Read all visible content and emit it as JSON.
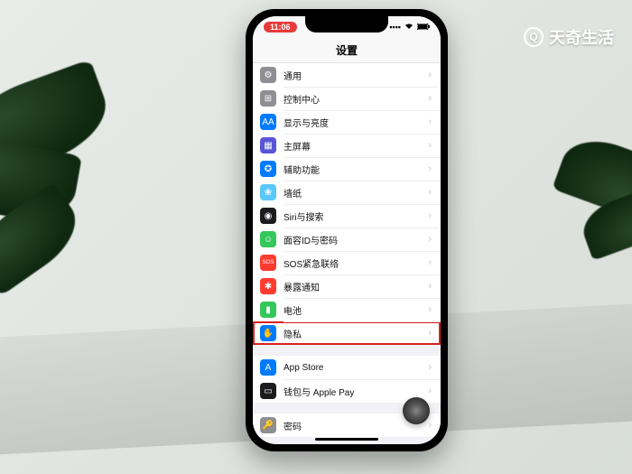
{
  "brand": {
    "text": "天奇生活",
    "icon_letter": "Q"
  },
  "statusbar": {
    "time": "11:06"
  },
  "navbar": {
    "title": "设置"
  },
  "groups": [
    {
      "rows": [
        {
          "name": "general",
          "label": "通用",
          "icon_bg": "bg-gray",
          "glyph": "⚙"
        },
        {
          "name": "control-center",
          "label": "控制中心",
          "icon_bg": "bg-gray",
          "glyph": "⊞"
        },
        {
          "name": "display",
          "label": "显示与亮度",
          "icon_bg": "bg-blue",
          "glyph": "AA"
        },
        {
          "name": "home-screen",
          "label": "主屏幕",
          "icon_bg": "bg-ind",
          "glyph": "▦"
        },
        {
          "name": "accessibility",
          "label": "辅助功能",
          "icon_bg": "bg-blue",
          "glyph": "✪"
        },
        {
          "name": "wallpaper",
          "label": "墙纸",
          "icon_bg": "bg-cyan",
          "glyph": "❀"
        },
        {
          "name": "siri",
          "label": "Siri与搜索",
          "icon_bg": "bg-dark",
          "glyph": "◉"
        },
        {
          "name": "faceid",
          "label": "面容ID与密码",
          "icon_bg": "bg-green",
          "glyph": "☺"
        },
        {
          "name": "sos",
          "label": "SOS紧急联络",
          "icon_bg": "bg-red",
          "glyph": "SOS"
        },
        {
          "name": "exposure",
          "label": "暴露通知",
          "icon_bg": "bg-red",
          "glyph": "✱"
        },
        {
          "name": "battery",
          "label": "电池",
          "icon_bg": "bg-green",
          "glyph": "▮"
        },
        {
          "name": "privacy",
          "label": "隐私",
          "icon_bg": "bg-blue",
          "glyph": "✋",
          "highlight": true
        }
      ]
    },
    {
      "rows": [
        {
          "name": "app-store",
          "label": "App Store",
          "icon_bg": "bg-blue",
          "glyph": "A"
        },
        {
          "name": "wallet",
          "label": "钱包与 Apple Pay",
          "icon_bg": "bg-dark",
          "glyph": "▭"
        }
      ]
    },
    {
      "rows": [
        {
          "name": "passwords",
          "label": "密码",
          "icon_bg": "bg-gray",
          "glyph": "🔑"
        }
      ]
    }
  ]
}
